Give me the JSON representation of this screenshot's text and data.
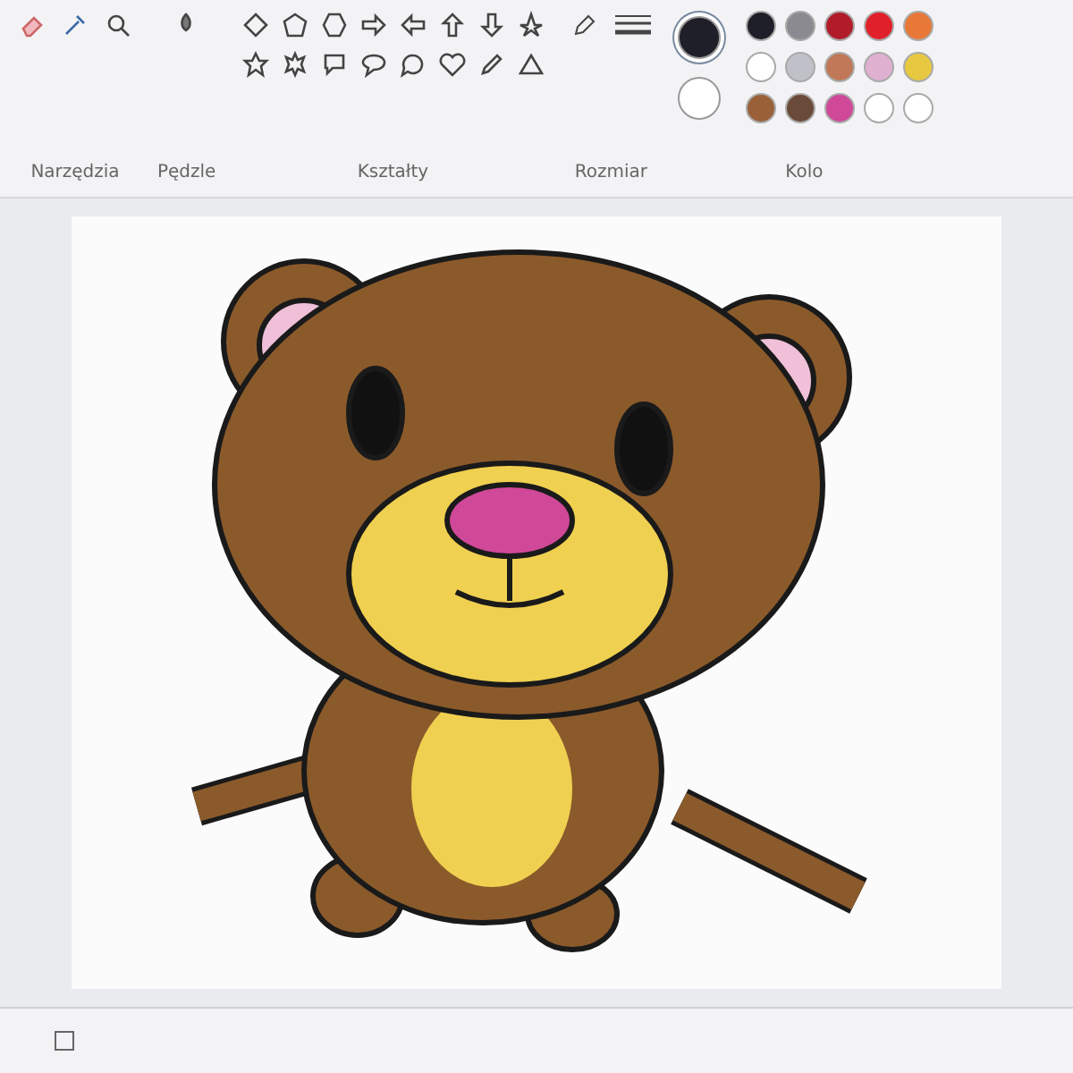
{
  "ribbon": {
    "groups": [
      {
        "kind": "tools",
        "label": "Narzędzia"
      },
      {
        "kind": "brushes",
        "label": "Pędzle"
      },
      {
        "kind": "shapes",
        "label": "Kształty"
      },
      {
        "kind": "size",
        "label": "Rozmiar"
      },
      {
        "kind": "colors",
        "label": "Kolo"
      }
    ]
  },
  "current_colors": [
    {
      "color": "#1f1f2a",
      "selected": true
    },
    {
      "color": "#ffffff",
      "selected": false
    }
  ],
  "palette": [
    {
      "color": "#1f1f2a"
    },
    {
      "color": "#8a8a90"
    },
    {
      "color": "#b01c2a"
    },
    {
      "color": "#e0202a"
    },
    {
      "color": "#e87838"
    },
    {
      "color": "#ffffff"
    },
    {
      "color": "#c0c0c8"
    },
    {
      "color": "#c07858"
    },
    {
      "color": "#e0b0d0"
    },
    {
      "color": "#e8c840"
    },
    {
      "color": "#9a6038"
    },
    {
      "color": "#6a4a38"
    },
    {
      "color": "#d04898"
    },
    {
      "color": "#ffffff"
    },
    {
      "color": "#ffffff"
    }
  ]
}
